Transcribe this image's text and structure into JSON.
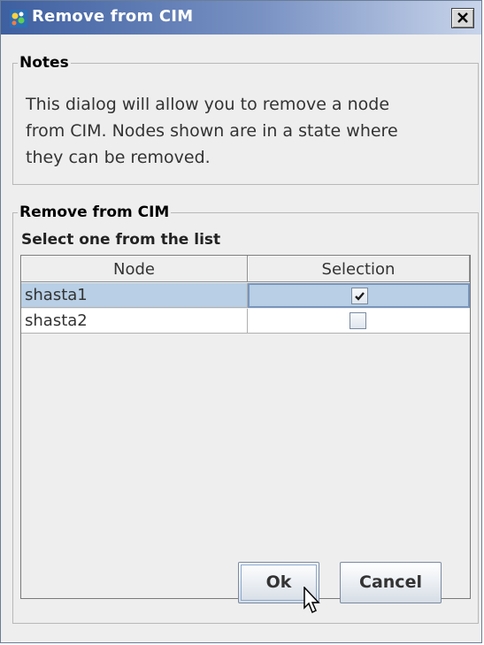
{
  "window": {
    "title": "Remove from CIM"
  },
  "notes": {
    "legend": "Notes",
    "lines": [
      "This dialog will allow you to remove a node",
      "from CIM.  Nodes shown are in a state where",
      "they can be removed."
    ]
  },
  "remove_panel": {
    "legend": "Remove from CIM",
    "list_caption": "Select one from the list",
    "columns": [
      "Node",
      "Selection"
    ],
    "rows": [
      {
        "node": "shasta1",
        "selected": true
      },
      {
        "node": "shasta2",
        "selected": false
      }
    ]
  },
  "buttons": {
    "ok": "Ok",
    "cancel": "Cancel"
  },
  "icons": {
    "app": "app-icon",
    "close": "close-icon",
    "check": "check-icon",
    "cursor": "mouse-pointer-icon"
  },
  "colors": {
    "title_bar": "#3e5fa0",
    "selected_row": "#b8cfe5"
  }
}
